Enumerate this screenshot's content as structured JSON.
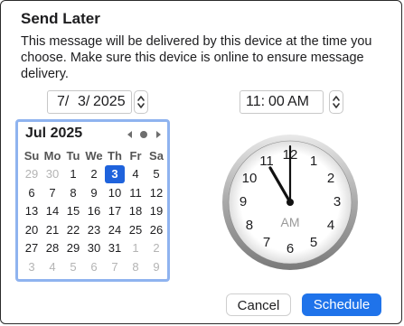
{
  "dialog": {
    "title": "Send Later",
    "message": "This message will be delivered by this device at the time you choose. Make sure this device is online to ensure message delivery."
  },
  "date_picker": {
    "month_seg": "7/",
    "day_seg": "3/",
    "year_seg": "2025"
  },
  "time_picker": {
    "hour_seg": "11:",
    "minute_seg": "00",
    "ampm_seg": "AM"
  },
  "calendar": {
    "month_label": "Jul 2025",
    "weekdays": [
      "Su",
      "Mo",
      "Tu",
      "We",
      "Th",
      "Fr",
      "Sa"
    ],
    "weeks": [
      [
        "29",
        "30",
        "1",
        "2",
        "3",
        "4",
        "5"
      ],
      [
        "6",
        "7",
        "8",
        "9",
        "10",
        "11",
        "12"
      ],
      [
        "13",
        "14",
        "15",
        "16",
        "17",
        "18",
        "19"
      ],
      [
        "20",
        "21",
        "22",
        "23",
        "24",
        "25",
        "26"
      ],
      [
        "27",
        "28",
        "29",
        "30",
        "31",
        "1",
        "2"
      ],
      [
        "3",
        "4",
        "5",
        "6",
        "7",
        "8",
        "9"
      ]
    ],
    "selected_day": "3"
  },
  "clock": {
    "numbers": [
      "12",
      "1",
      "2",
      "3",
      "4",
      "5",
      "6",
      "7",
      "8",
      "9",
      "10",
      "11"
    ],
    "period": "AM",
    "hour": 11,
    "minute": 0
  },
  "buttons": {
    "cancel": "Cancel",
    "schedule": "Schedule"
  },
  "colors": {
    "accent": "#1f73ea",
    "selected_day": "#1f63dc",
    "calendar_focus": "#8fb3ef"
  }
}
